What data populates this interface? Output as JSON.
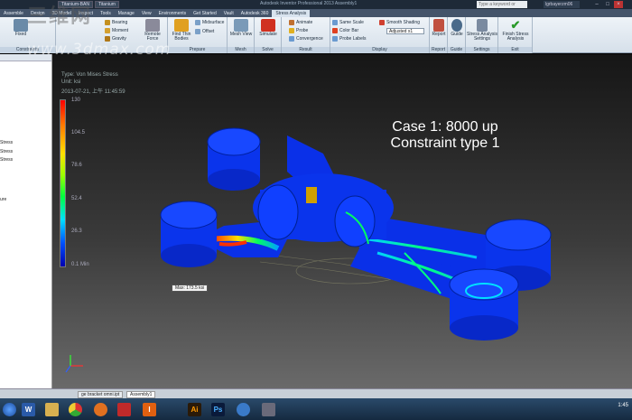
{
  "titlebar": {
    "tabs": [
      "Titanium-BAN",
      "Titanium"
    ],
    "app_title": "Autodesk Inventor Professional 2013  Assembly1",
    "search_placeholder": "Type a keyword or phrase",
    "user": "lgrbayerzm06"
  },
  "ribbon_tabs": [
    "Assemble",
    "Design",
    "3D Model",
    "Inspect",
    "Tools",
    "Manage",
    "View",
    "Environments",
    "Get Started",
    "Vault",
    "Autodesk 360",
    "Stress Analysis"
  ],
  "ribbon_active": "Stress Analysis",
  "ribbon": {
    "fixed": "Fixed",
    "bearing": "Bearing",
    "moment": "Moment",
    "gravity": "Gravity",
    "remote": "Remote Force",
    "find_thin": "Find Thin Bodies",
    "midsurface": "Midsurface",
    "offset": "Offset",
    "mesh_view": "Mesh View",
    "simulate": "Simulate",
    "animate": "Animate",
    "probe": "Probe",
    "convergence": "Convergence",
    "same_scale": "Same Scale",
    "color_bar": "Color Bar",
    "probe_labels": "Probe Labels",
    "smooth_shading": "Smooth Shading",
    "adjusted": "Adjusted x1",
    "report": "Report",
    "guide": "Guide",
    "stress_settings": "Stress Analysis Settings",
    "finish": "Finish Stress Analysis",
    "panels": {
      "constraints": "Constraints",
      "prepare": "Prepare",
      "mesh": "Mesh",
      "solve": "Solve",
      "result": "Result",
      "display": "Display",
      "report": "Report",
      "guide": "Guide",
      "settings": "Settings",
      "exit": "Exit"
    }
  },
  "watermark": {
    "top": "三维网",
    "url": "www.3dmax.com"
  },
  "browser": {
    "items": [
      "Stress",
      "Stress",
      "Stress",
      "ure"
    ]
  },
  "viewport": {
    "type_line": "Type: Von Mises Stress",
    "unit_line": "Unit: ksi",
    "date_line": "2013-07-21, 上午 11:45:59",
    "legend_ticks": [
      "130",
      "104.5",
      "78.6",
      "52.4",
      "26.3",
      "0.1 Min"
    ],
    "case_title": "Case 1: 8000 up",
    "case_sub": "Constraint type 1",
    "max_label": "Max: 173.5 ksi"
  },
  "status_tabs": [
    "ge bracket omni.ipt",
    "Assembly1"
  ],
  "taskbar": {
    "icons": [
      "start-orb",
      "word",
      "files",
      "chrome",
      "browser",
      "media",
      "inventor",
      "illustrator",
      "photoshop",
      "globe",
      "misc"
    ],
    "time": "1:45"
  },
  "colors": {
    "ribbon_bg": "#dce6f0",
    "viewport_top": "#161616",
    "viewport_bottom": "#6a6a6a",
    "mesh_blue": "#0033ee"
  }
}
